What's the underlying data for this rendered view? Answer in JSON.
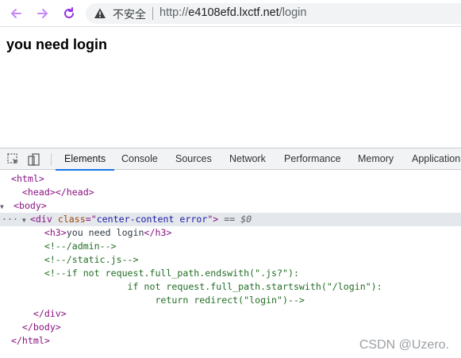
{
  "browser": {
    "insecure_label": "不安全",
    "url_proto": "http://",
    "url_host": "e4108efd.lxctf.net",
    "url_path": "/login"
  },
  "page": {
    "heading": "you need login"
  },
  "devtools": {
    "tabs": [
      "Elements",
      "Console",
      "Sources",
      "Network",
      "Performance",
      "Memory",
      "Application"
    ],
    "active_tab": "Elements",
    "dom": {
      "l1": "<html>",
      "l2_open": "<head>",
      "l2_close": "</head>",
      "l3": "<body>",
      "l4_tag_open": "<div ",
      "l4_attr": "class",
      "l4_eq": "=\"",
      "l4_val": "center-content error",
      "l4_end": "\">",
      "l4_marker": " == $0",
      "l5_open": "<h3>",
      "l5_text": "you need login",
      "l5_close": "</h3>",
      "l6": "<!--/admin-->",
      "l7": "<!--/static.js-->",
      "l8": "<!--if not request.full_path.endswith(\".js?\"):",
      "l9": "if not request.full_path.startswith(\"/login\"):",
      "l10": "return redirect(\"login\")-->",
      "l11": "</div>",
      "l12": "</body>",
      "l13": "</html>"
    }
  },
  "watermark": "CSDN @Uzero."
}
